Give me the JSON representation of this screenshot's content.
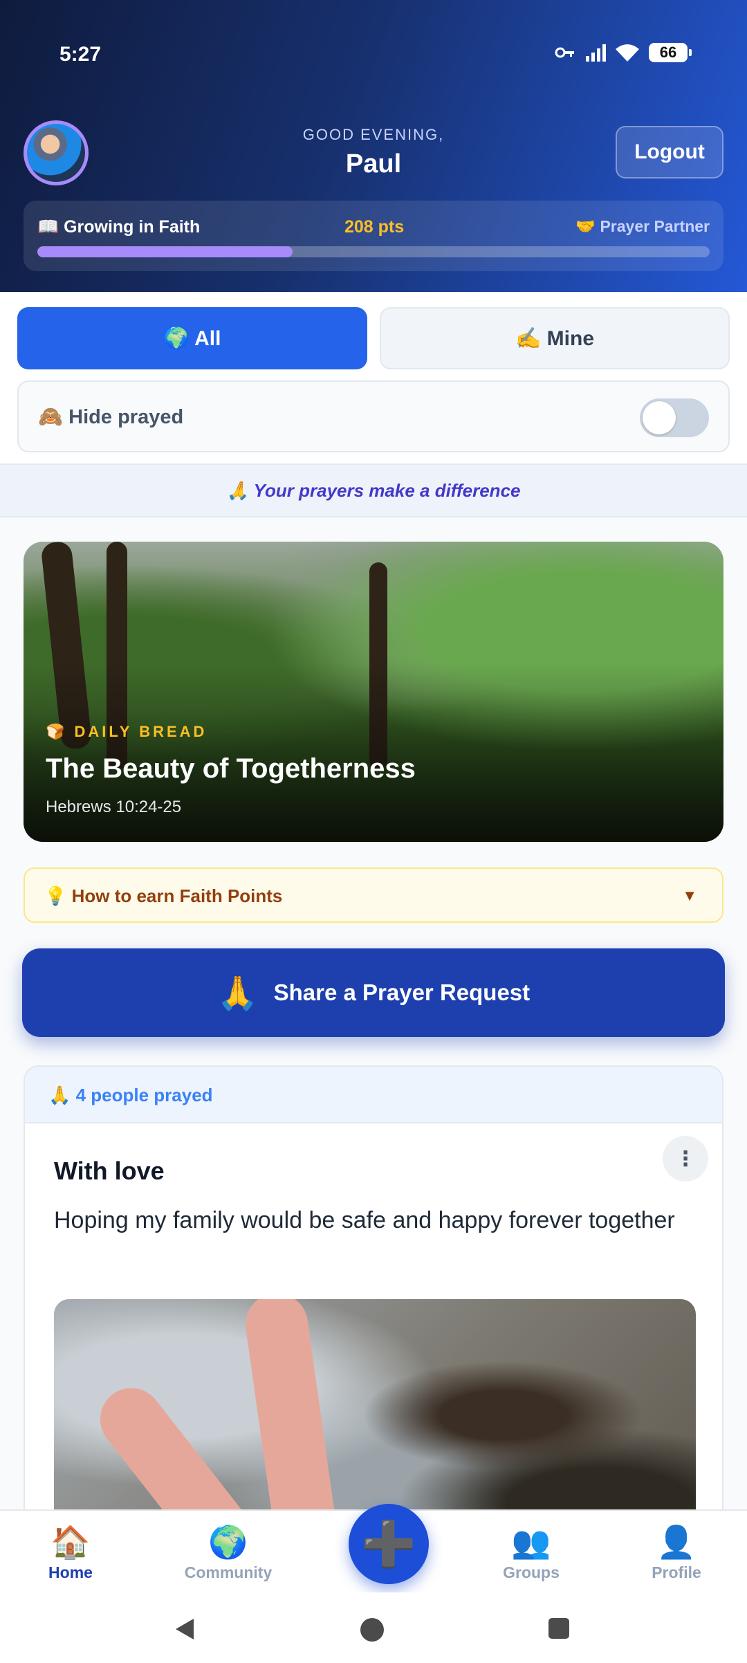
{
  "status": {
    "time": "5:27",
    "battery": "66"
  },
  "header": {
    "greeting": "GOOD EVENING,",
    "name": "Paul",
    "logout_label": "Logout",
    "level_label": "📖 Growing in Faith",
    "points": "208 pts",
    "next_level": "🤝 Prayer Partner",
    "progress_fraction": 0.38
  },
  "filters": {
    "all_label": "🌍 All",
    "mine_label": "✍️ Mine",
    "hide_prayed_label": "🙈 Hide prayed",
    "hide_prayed_on": false
  },
  "banner": "🙏 Your prayers make a difference",
  "daily_bread": {
    "tag": "🍞 DAILY BREAD",
    "title": "The Beauty of Togetherness",
    "reference": "Hebrews 10:24-25"
  },
  "earn": {
    "label": "💡 How to earn Faith Points",
    "caret": "▼"
  },
  "share": {
    "icon": "🙏",
    "label": "Share a Prayer Request"
  },
  "post": {
    "prayed_count": "🙏 4 people prayed",
    "title": "With love",
    "body": "Hoping my family would be safe and happy forever together"
  },
  "nav": {
    "items": [
      {
        "icon": "🏠",
        "label": "Home"
      },
      {
        "icon": "🌍",
        "label": "Community"
      },
      {
        "icon": "👥",
        "label": "Groups"
      },
      {
        "icon": "👤",
        "label": "Profile"
      }
    ],
    "fab_icon": "➕"
  },
  "colors": {
    "primary": "#2563eb",
    "accent_purple": "#a78bfa",
    "points_gold": "#fbbf24"
  }
}
